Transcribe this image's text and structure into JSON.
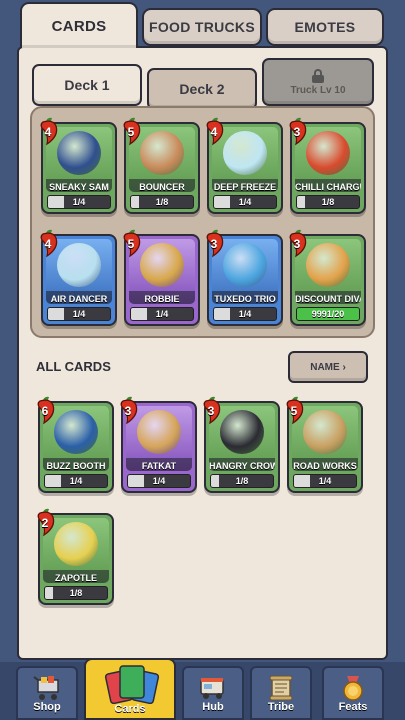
{
  "tabs": [
    {
      "label": "CARDS",
      "active": true
    },
    {
      "label": "FOOD TRUCKS",
      "active": false
    },
    {
      "label": "EMOTES",
      "active": false
    }
  ],
  "decks": [
    {
      "label": "Deck 1",
      "active": true
    },
    {
      "label": "Deck 2",
      "active": false
    },
    {
      "label": "Truck Lv 10",
      "locked": true,
      "icon": "lock-icon"
    }
  ],
  "deck_cards": [
    {
      "name": "SNEAKY SAM",
      "cost": "4",
      "progress": "1/4",
      "level": 0.25,
      "rarity": "green"
    },
    {
      "name": "BOUNCER",
      "cost": "5",
      "progress": "1/8",
      "level": 0.125,
      "rarity": "green"
    },
    {
      "name": "DEEP FREEZE",
      "cost": "4",
      "progress": "1/4",
      "level": 0.25,
      "rarity": "green"
    },
    {
      "name": "CHILLI CHARGE",
      "cost": "3",
      "progress": "1/8",
      "level": 0.125,
      "rarity": "green"
    },
    {
      "name": "AIR DANCER",
      "cost": "4",
      "progress": "1/4",
      "level": 0.25,
      "rarity": "blue"
    },
    {
      "name": "ROBBIE",
      "cost": "5",
      "progress": "1/4",
      "level": 0.25,
      "rarity": "purple"
    },
    {
      "name": "TUXEDO TRIO",
      "cost": "3",
      "progress": "1/4",
      "level": 0.25,
      "rarity": "blue"
    },
    {
      "name": "DISCOUNT DIVA",
      "cost": "3",
      "progress": "9991/20",
      "level": 1.0,
      "rarity": "green"
    }
  ],
  "all_cards_title": "ALL CARDS",
  "sort_button": "NAME ›",
  "all_cards": [
    {
      "name": "BUZZ BOOTH",
      "cost": "6",
      "progress": "1/4",
      "level": 0.25,
      "rarity": "green"
    },
    {
      "name": "FATKAT",
      "cost": "3",
      "progress": "1/4",
      "level": 0.25,
      "rarity": "purple"
    },
    {
      "name": "HANGRY CROWS",
      "cost": "3",
      "progress": "1/8",
      "level": 0.125,
      "rarity": "green"
    },
    {
      "name": "ROAD WORKS",
      "cost": "5",
      "progress": "1/4",
      "level": 0.25,
      "rarity": "green"
    },
    {
      "name": "ZAPOTLE",
      "cost": "2",
      "progress": "1/8",
      "level": 0.125,
      "rarity": "green"
    }
  ],
  "nav": [
    {
      "label": "Shop",
      "icon": "shopping-cart-icon"
    },
    {
      "label": "Cards",
      "icon": "cards-icon",
      "active": true
    },
    {
      "label": "Hub",
      "icon": "food-truck-icon"
    },
    {
      "label": "Tribe",
      "icon": "scroll-icon"
    },
    {
      "label": "Feats",
      "icon": "medal-icon"
    }
  ]
}
